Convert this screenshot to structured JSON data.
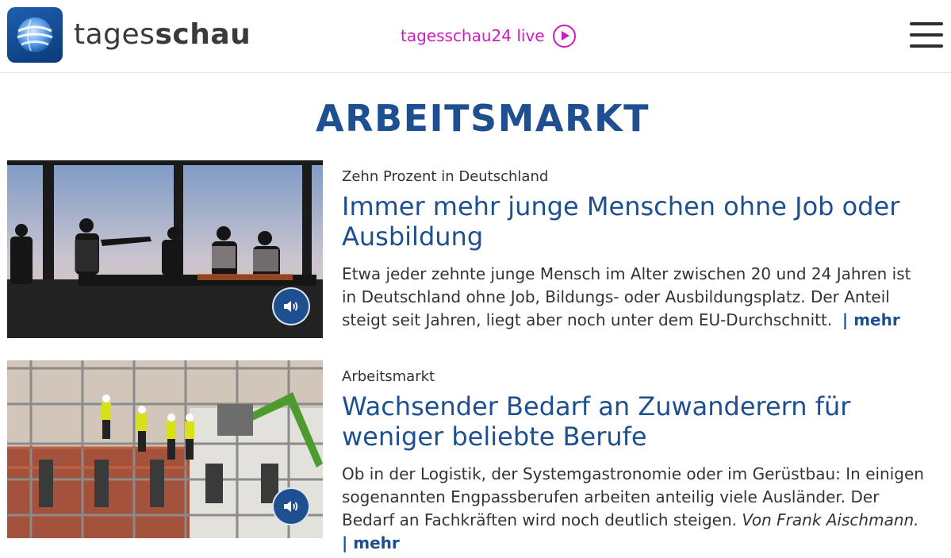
{
  "header": {
    "brand_light": "tages",
    "brand_bold": "schau",
    "live_label": "tagesschau24 live",
    "logo_icon": "tagesschau-globe-logo",
    "live_icon": "play-circle-icon",
    "menu_icon": "hamburger-menu-icon",
    "live_color": "#d01cbd"
  },
  "section": {
    "title": "ARBEITSMARKT",
    "accent_color": "#1d4f91"
  },
  "teasers": [
    {
      "topline": "Zehn Prozent in Deutschland",
      "headline": "Immer mehr junge Menschen ohne Job oder Ausbildung",
      "body": "Etwa jeder zehnte junge Mensch im Alter zwischen 20 und 24 Jahren ist in Deutschland ohne Job, Bildungs- oder Ausbildungsplatz. Der Anteil steigt seit Jahren, liegt aber noch unter dem EU-Durchschnitt.",
      "author": "",
      "more": "| mehr",
      "audio_icon": "speaker-icon"
    },
    {
      "topline": "Arbeitsmarkt",
      "headline": "Wachsender Bedarf an Zuwanderern für weniger beliebte Berufe",
      "body": "Ob in der Logistik, der Systemgastronomie oder im Gerüstbau: In einigen sogenannten Engpassberufen arbeiten anteilig viele Ausländer. Der Bedarf an Fachkräften wird noch deutlich steigen.",
      "author": "Von Frank Aischmann.",
      "more": "| mehr",
      "audio_icon": "speaker-icon"
    }
  ]
}
